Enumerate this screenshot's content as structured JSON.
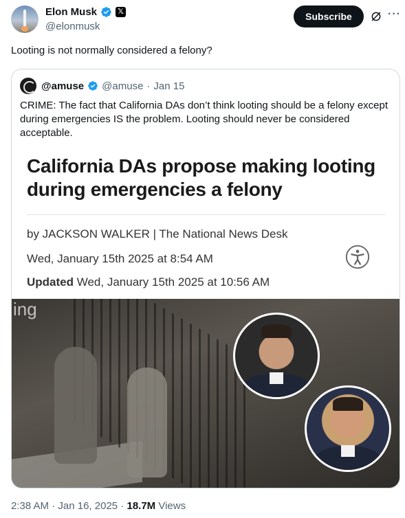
{
  "author": {
    "display_name": "Elon Musk",
    "handle": "@elonmusk"
  },
  "actions": {
    "subscribe_label": "Subscribe",
    "more_label": "···"
  },
  "tweet": {
    "text": "Looting is not normally considered a felony?"
  },
  "quoted": {
    "display_name": "@amuse",
    "handle": "@amuse",
    "separator": "·",
    "date": "Jan 15",
    "text": "CRIME: The fact that California DAs don’t think looting should be a felony except during emergencies IS the problem. Looting should never be considered acceptable."
  },
  "article": {
    "headline": "California DAs propose making looting during emergencies a felony",
    "byline": "by JACKSON WALKER | The National News Desk",
    "date": "Wed, January 15th 2025 at 8:54 AM",
    "updated_label": "Updated",
    "updated_date": "Wed, January 15th 2025 at 10:56 AM"
  },
  "photo": {
    "overlay_text": "ing"
  },
  "footer": {
    "time": "2:38 AM",
    "date": "Jan 16, 2025",
    "separator": "·",
    "views_count": "18.7M",
    "views_label": "Views"
  },
  "colors": {
    "verified_blue": "#1d9bf0",
    "muted_text": "#536471",
    "primary_text": "#0f1419"
  }
}
